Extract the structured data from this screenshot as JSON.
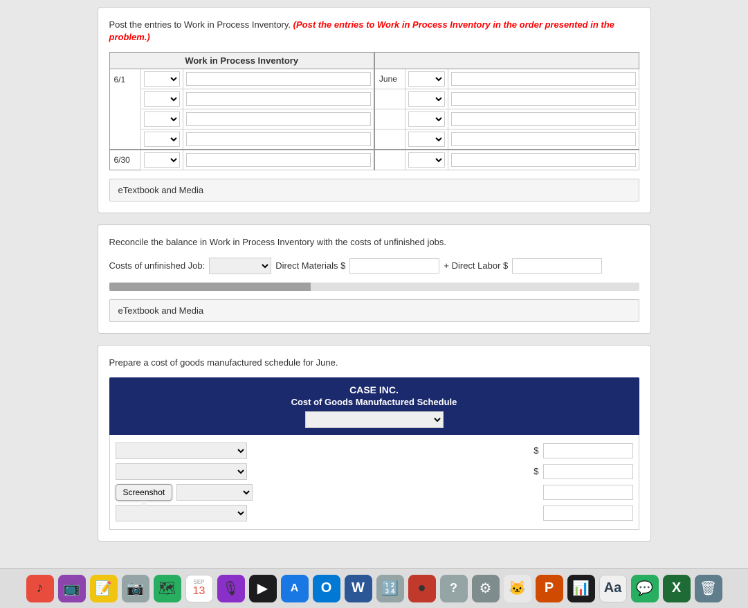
{
  "sections": {
    "wip_section": {
      "label_normal": "Post the entries to Work in Process Inventory.",
      "label_red": "(Post the entries to Work in Process Inventory in the order presented in the problem.)",
      "table_header": "Work in Process Inventory",
      "rows_left": [
        {
          "date": "6/1",
          "select_val": "",
          "input_val": ""
        },
        {
          "date": "",
          "select_val": "",
          "input_val": ""
        },
        {
          "date": "",
          "select_val": "",
          "input_val": ""
        },
        {
          "date": "",
          "select_val": "",
          "input_val": ""
        }
      ],
      "rows_right": [
        {
          "month": "June",
          "select_val": "",
          "input_val": ""
        },
        {
          "month": "",
          "select_val": "",
          "input_val": ""
        },
        {
          "month": "",
          "select_val": "",
          "input_val": ""
        },
        {
          "month": "",
          "select_val": "",
          "input_val": ""
        }
      ],
      "bottom_row_left": {
        "date": "6/30",
        "select_val": "",
        "input_val": ""
      },
      "bottom_row_right": {
        "select_val": "",
        "input_val": ""
      },
      "etextbook_label": "eTextbook and Media"
    },
    "reconcile_section": {
      "label": "Reconcile the balance in Work in Process Inventory with the costs of unfinished jobs.",
      "costs_label": "Costs of unfinished Job:",
      "direct_materials_label": "Direct Materials $",
      "plus_direct_labor_label": "+ Direct Labor $",
      "etextbook_label": "eTextbook and Media",
      "progress_pct": 38
    },
    "cogm_section": {
      "label": "Prepare a cost of goods manufactured schedule for June.",
      "header_title": "CASE INC.",
      "header_subtitle": "Cost of Goods Manufactured Schedule",
      "header_dropdown_placeholder": "",
      "rows": [
        {
          "select_val": "",
          "dollar_sign": "$",
          "input_val": "",
          "position": "right-dollar"
        },
        {
          "select_val": "",
          "dollar_sign": "$",
          "input_val": "",
          "position": "mid-dollar"
        },
        {
          "select_val": "",
          "dollar_sign": "",
          "input_val": "",
          "position": "input-only"
        },
        {
          "select_val": "",
          "dollar_sign": "",
          "input_val": "",
          "position": "input-only"
        }
      ],
      "screenshot_label": "Screenshot"
    }
  },
  "dock": {
    "items": [
      {
        "name": "music",
        "icon": "♪",
        "color": "red"
      },
      {
        "name": "twitch",
        "icon": "📺",
        "color": "purple"
      },
      {
        "name": "notes",
        "icon": "📝",
        "color": "yellow"
      },
      {
        "name": "camera",
        "icon": "📷",
        "color": "gray"
      },
      {
        "name": "maps",
        "icon": "🗺",
        "color": "green"
      },
      {
        "name": "calendar",
        "icon": "📅",
        "color": "white"
      },
      {
        "name": "podcasts",
        "icon": "🎙",
        "color": "purple"
      },
      {
        "name": "appletv",
        "icon": "▶",
        "color": "dark"
      },
      {
        "name": "appstore",
        "icon": "A",
        "color": "blue"
      },
      {
        "name": "outlook",
        "icon": "O",
        "color": "blue"
      },
      {
        "name": "word",
        "icon": "W",
        "color": "blue"
      },
      {
        "name": "calculator",
        "icon": "🔢",
        "color": "gray"
      },
      {
        "name": "redsphere",
        "icon": "●",
        "color": "dred"
      },
      {
        "name": "help",
        "icon": "?",
        "color": "gray"
      },
      {
        "name": "sysprefs",
        "icon": "⚙",
        "color": "gray"
      },
      {
        "name": "cat",
        "icon": "🐱",
        "color": "gray"
      },
      {
        "name": "powerpoint",
        "icon": "P",
        "color": "orange"
      },
      {
        "name": "activity",
        "icon": "📊",
        "color": "dark"
      },
      {
        "name": "dict",
        "icon": "D",
        "color": "white"
      },
      {
        "name": "messages",
        "icon": "💬",
        "color": "green"
      },
      {
        "name": "excel",
        "icon": "X",
        "color": "xgreen"
      },
      {
        "name": "trash",
        "icon": "🗑",
        "color": "trash"
      }
    ]
  }
}
